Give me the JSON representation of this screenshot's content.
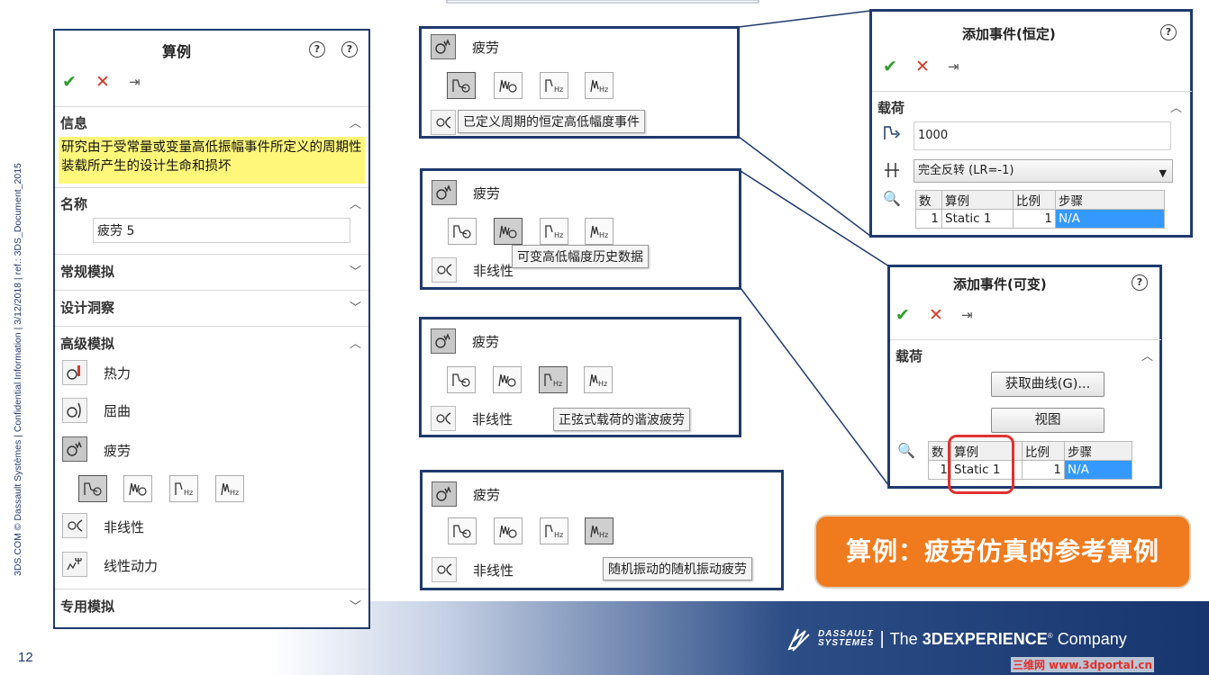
{
  "slide": {
    "side_text": "3DS.COM © Dassault Systèmes | Confidential Information | 3/12/2018 | ref.: 3DS_Document_2015",
    "page_number": "12",
    "brand": {
      "ds_line1": "DASSAULT",
      "ds_line2": "SYSTEMES",
      "separator": "|",
      "the": "The",
      "experience": "3DEXPERIENCE",
      "company": "Company"
    },
    "watermark": "三维网 www.3dportal.cn",
    "callout": "算例：疲劳仿真的参考算例"
  },
  "left_panel": {
    "title": "算例",
    "info": {
      "header": "信息",
      "text": "研究由于受常量或变量高低振幅事件所定义的周期性装载所产生的设计生命和损坏"
    },
    "name": {
      "header": "名称",
      "value": "疲劳 5"
    },
    "sections": {
      "general": "常规模拟",
      "design": "设计洞察",
      "advanced": "高级模拟",
      "special": "专用模拟"
    },
    "tools": [
      {
        "label": "热力",
        "icon": "thermal-icon"
      },
      {
        "label": "屈曲",
        "icon": "buckling-icon"
      },
      {
        "label": "疲劳",
        "icon": "fatigue-icon"
      },
      {
        "label": "非线性",
        "icon": "nonlinear-icon"
      },
      {
        "label": "线性动力",
        "icon": "linear-dynamic-icon"
      }
    ]
  },
  "fatigue_boxes": [
    {
      "label": "疲劳",
      "nonlinear": "",
      "tooltip": "已定义周期的恒定高低幅度事件",
      "active_sub": 0
    },
    {
      "label": "疲劳",
      "nonlinear": "非线性",
      "tooltip": "可变高低幅度历史数据",
      "active_sub": 1
    },
    {
      "label": "疲劳",
      "nonlinear": "非线性",
      "tooltip": "正弦式载荷的谐波疲劳",
      "active_sub": 2
    },
    {
      "label": "疲劳",
      "nonlinear": "非线性",
      "tooltip": "随机振动的随机振动疲劳",
      "active_sub": 3
    }
  ],
  "dialog_constant": {
    "title": "添加事件(恒定)",
    "section": "载荷",
    "cycles_value": "1000",
    "loading_type": "完全反转 (LR=-1)",
    "table": {
      "headers": [
        "数",
        "算例",
        "比例",
        "步骤"
      ],
      "row": [
        "1",
        "Static 1",
        "1",
        "N/A"
      ]
    }
  },
  "dialog_variable": {
    "title": "添加事件(可变)",
    "section": "载荷",
    "get_curve_button": "获取曲线(G)...",
    "view_button": "视图",
    "table": {
      "headers": [
        "数",
        "算例",
        "比例",
        "步骤"
      ],
      "row": [
        "1",
        "Static 1",
        "1",
        "N/A"
      ]
    }
  },
  "colors": {
    "frame": "#1f3a6d",
    "callout": "#f07b1e",
    "info_highlight": "#fff77a",
    "selection": "#3399ff",
    "ring": "#e23030"
  }
}
